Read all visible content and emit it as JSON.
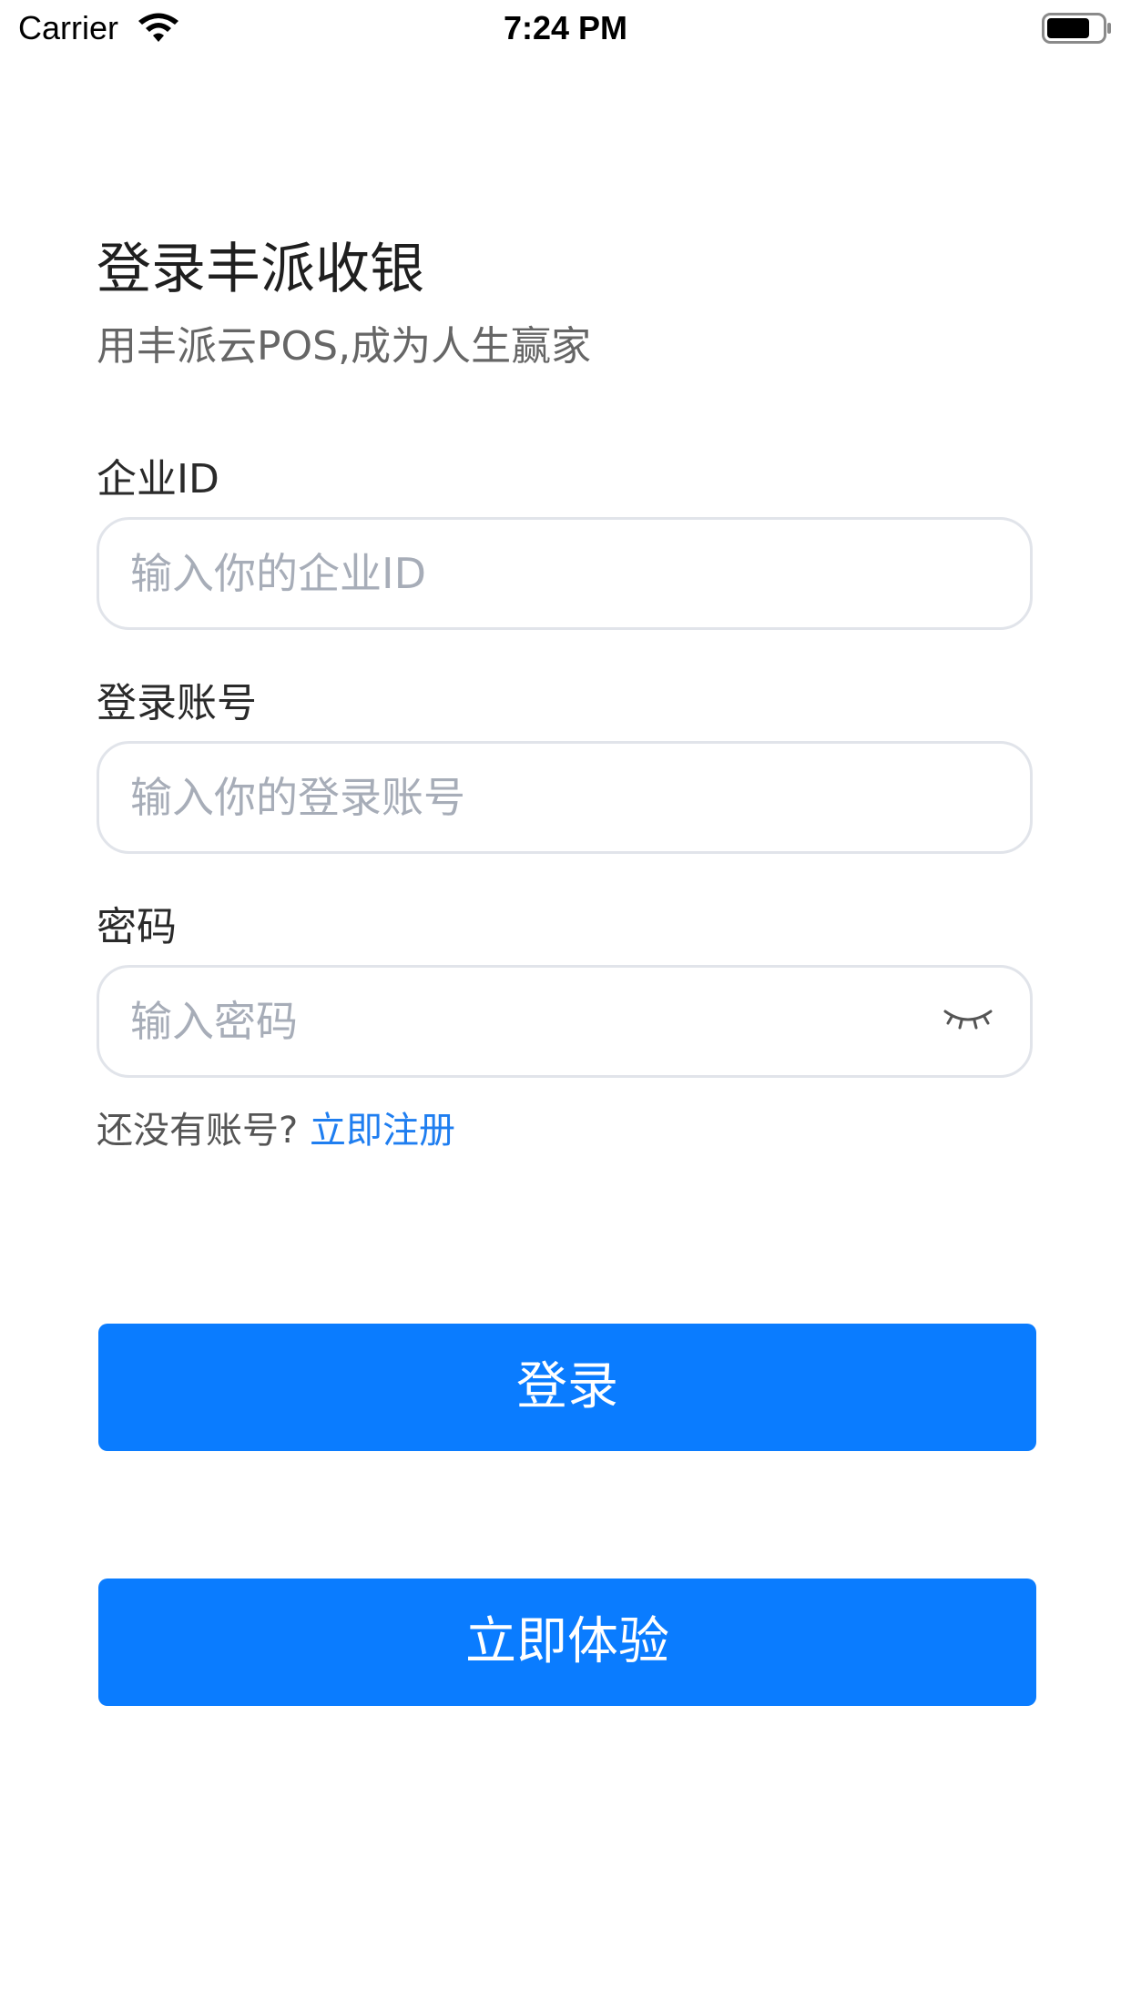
{
  "status_bar": {
    "carrier": "Carrier",
    "time": "7:24 PM",
    "wifi_icon": "wifi-icon",
    "battery_icon": "battery-icon"
  },
  "header": {
    "title": "登录丰派收银",
    "subtitle": "用丰派云POS,成为人生赢家"
  },
  "form": {
    "company_id": {
      "label": "企业ID",
      "placeholder": "输入你的企业ID",
      "value": ""
    },
    "account": {
      "label": "登录账号",
      "placeholder": "输入你的登录账号",
      "value": ""
    },
    "password": {
      "label": "密码",
      "placeholder": "输入密码",
      "value": "",
      "toggle_icon": "eye-closed-icon"
    }
  },
  "register": {
    "prompt": "还没有账号?",
    "link": "立即注册"
  },
  "actions": {
    "login_label": "登录",
    "trial_label": "立即体验"
  },
  "colors": {
    "primary": "#0a7cff",
    "link": "#1f7ef0",
    "placeholder": "#a7adb8",
    "border": "#e1e4ea"
  }
}
